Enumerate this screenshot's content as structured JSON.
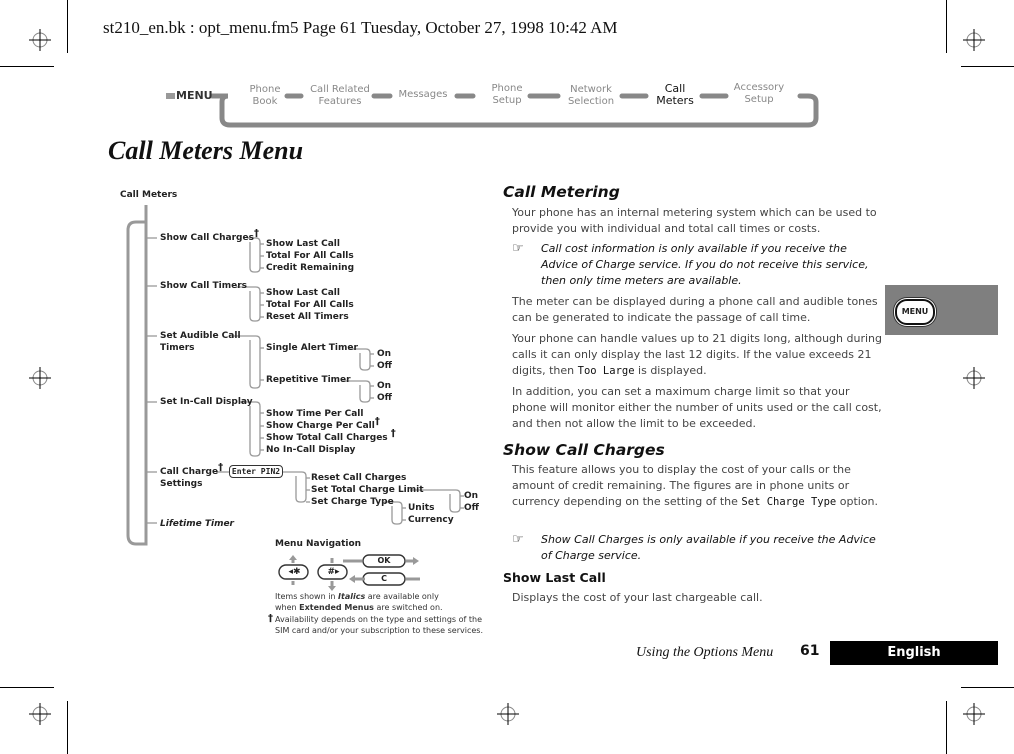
{
  "print_header": "st210_en.bk : opt_menu.fm5  Page 61  Tuesday, October 27, 1998  10:42 AM",
  "nav": {
    "menu_label": "MENU",
    "items": [
      {
        "line1": "Phone",
        "line2": "Book",
        "active": false
      },
      {
        "line1": "Call Related",
        "line2": "Features",
        "active": false
      },
      {
        "line1": "Messages",
        "line2": "",
        "active": false
      },
      {
        "line1": "Phone",
        "line2": "Setup",
        "active": false
      },
      {
        "line1": "Network",
        "line2": "Selection",
        "active": false
      },
      {
        "line1": "Call",
        "line2": "Meters",
        "active": true
      },
      {
        "line1": "Accessory",
        "line2": "Setup",
        "active": false
      }
    ]
  },
  "page_title": "Call Meters Menu",
  "tree": {
    "root": "Call Meters",
    "level1": [
      "Show Call Charges",
      "Show Call Timers",
      "Set Audible Call",
      "Timers",
      "Set In-Call Display",
      "Call Charge",
      "Settings",
      "Lifetime Timer"
    ],
    "show_call_charges": [
      "Show Last Call",
      "Total For All Calls",
      "Credit Remaining"
    ],
    "show_call_timers": [
      "Show Last Call",
      "Total For All Calls",
      "Reset All Timers"
    ],
    "audible": [
      "Single Alert Timer",
      "Repetitive Timer"
    ],
    "on_off": [
      "On",
      "Off"
    ],
    "in_call": [
      "Show Time Per Call",
      "Show Charge Per Call",
      "Show Total Call Charges",
      "No In-Call Display"
    ],
    "pin_prompt": "Enter PIN2",
    "charge_settings": [
      "Reset Call Charges",
      "Set Total Charge Limit",
      "Set Charge Type"
    ],
    "charge_type": [
      "Units",
      "Currency"
    ],
    "dagger": "†"
  },
  "legend": {
    "title": "Menu Navigation",
    "keys": [
      "◂✱",
      "#▸",
      "OK",
      "C"
    ],
    "italics_note_1a": "Items shown in ",
    "italics_note_1b": "Italics",
    "italics_note_1c": " are available only",
    "italics_note_2a": "when ",
    "italics_note_2b": "Extended Menus",
    "italics_note_2c": " are switched on.",
    "dagger_note_1": "Availability depends on the type and settings of the",
    "dagger_note_2": "SIM card and/or your subscription to these services."
  },
  "content": {
    "h_call_metering": "Call Metering",
    "p1": "Your phone has an internal metering system which can be used to provide you with individual and total call times or costs.",
    "note1": "Call cost information is only available if you receive the Advice of Charge service. If you do not receive this service, then only time meters are available.",
    "p2": "The meter can be displayed during a phone call and audible tones can be generated to indicate the passage of call time.",
    "p3a": "Your phone can handle values up to 21 digits long, although during calls it can only display the last 12 digits. If the value exceeds 21 digits, then ",
    "p3_mono": "Too Large",
    "p3b": " is displayed.",
    "p4": "In addition, you can set a maximum charge limit so that your phone will monitor either the number of units used or the call cost, and then not allow the limit to be exceeded.",
    "h_show_call_charges": "Show Call Charges",
    "p5a": "This feature allows you to display the cost of your calls or the amount of credit remaining. The figures are in phone units or currency depending on the setting of the ",
    "p5_mono": "Set Charge Type",
    "p5b": " option.",
    "note2": "Show Call Charges is only available if you receive the Advice of Charge service.",
    "h_show_last_call": "Show Last Call",
    "p6": "Displays the cost of your last chargeable call."
  },
  "side_tab": {
    "button_label": "MENU"
  },
  "footer": {
    "section": "Using the Options Menu",
    "page_number": "61",
    "language": "English"
  }
}
